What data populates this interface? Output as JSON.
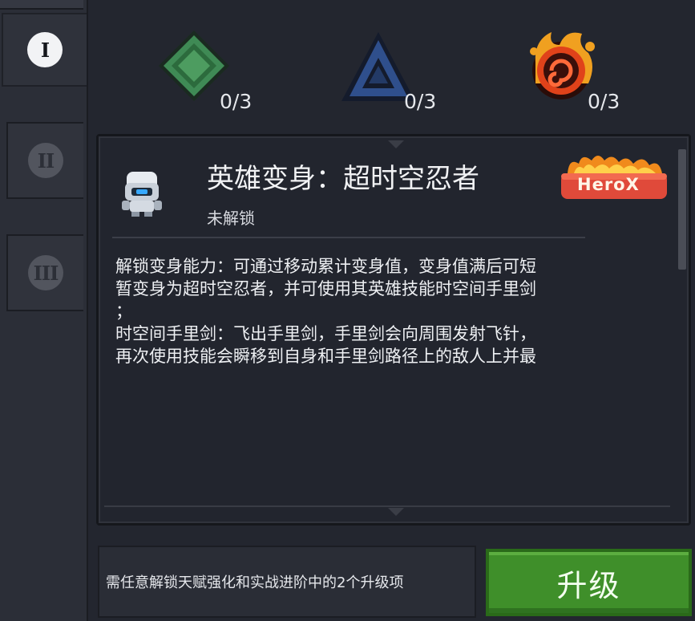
{
  "tabs": [
    {
      "numeral": "I",
      "active": true
    },
    {
      "numeral": "II",
      "active": false
    },
    {
      "numeral": "III",
      "active": false
    }
  ],
  "gems": [
    {
      "icon": "green-diamond-gem-icon",
      "count": "0/3",
      "color": "#3f8a55"
    },
    {
      "icon": "blue-triangle-gem-icon",
      "count": "0/3",
      "color": "#2f4f8c"
    },
    {
      "icon": "fire-swirl-gem-icon",
      "count": "0/3",
      "color": "#e0421a"
    }
  ],
  "talent": {
    "title": "英雄变身：超时空忍者",
    "status": "未解锁",
    "badge": "HeroX",
    "description": "解锁变身能力：可通过移动累计变身值，变身值满后可短\n暂变身为超时空忍者，并可使用其英雄技能时空间手里剑\n；\n时空间手里剑：飞出手里剑，手里剑会向周围发射飞针，\n再次使用技能会瞬移到自身和手里剑路径上的敌人上并最"
  },
  "footer": {
    "requirement": "需任意解锁天赋强化和实战进阶中的2个升级项",
    "upgrade_label": "升级"
  },
  "colors": {
    "accent_green": "#3f8f2a",
    "badge_red": "#e04a3a",
    "badge_orange": "#f08a1c"
  }
}
